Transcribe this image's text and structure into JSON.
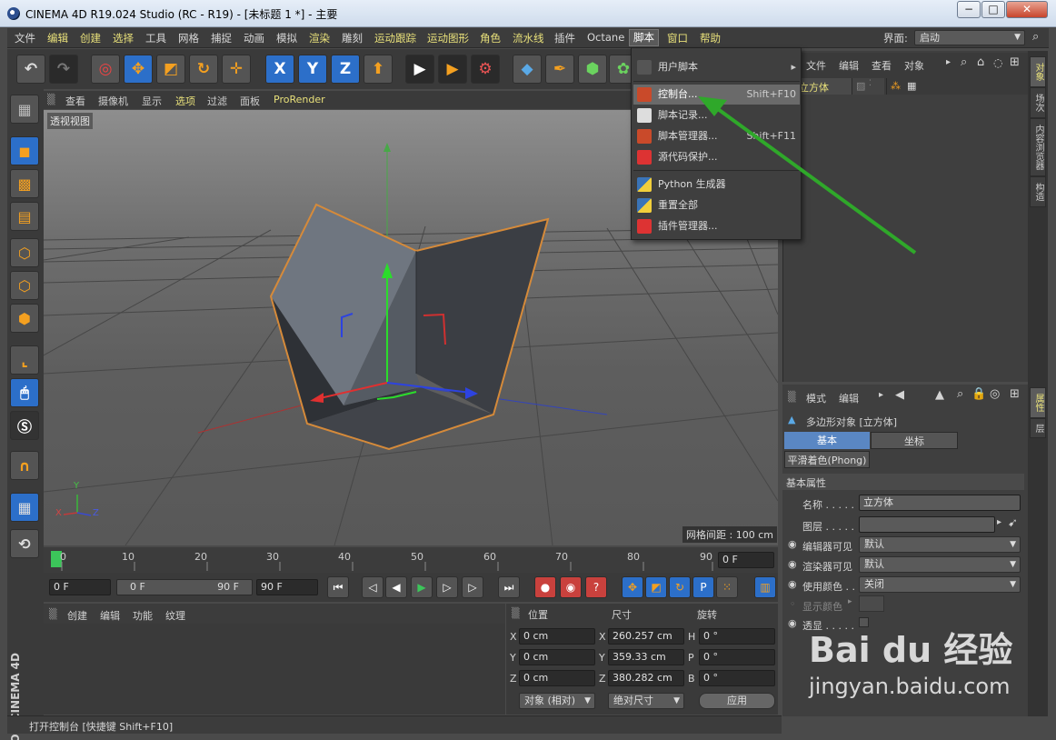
{
  "window": {
    "title": "CINEMA 4D R19.024 Studio (RC - R19) - [未标题 1 *] - 主要",
    "min": "−",
    "max": "□",
    "close": "✕"
  },
  "menubar": {
    "items": [
      {
        "label": "文件",
        "yellow": false
      },
      {
        "label": "编辑",
        "yellow": true
      },
      {
        "label": "创建",
        "yellow": true
      },
      {
        "label": "选择",
        "yellow": true
      },
      {
        "label": "工具",
        "yellow": false
      },
      {
        "label": "网格",
        "yellow": false
      },
      {
        "label": "捕捉",
        "yellow": false
      },
      {
        "label": "动画",
        "yellow": false
      },
      {
        "label": "模拟",
        "yellow": false
      },
      {
        "label": "渲染",
        "yellow": true
      },
      {
        "label": "雕刻",
        "yellow": false
      },
      {
        "label": "运动跟踪",
        "yellow": true
      },
      {
        "label": "运动图形",
        "yellow": true
      },
      {
        "label": "角色",
        "yellow": true
      },
      {
        "label": "流水线",
        "yellow": true
      },
      {
        "label": "插件",
        "yellow": false
      },
      {
        "label": "Octane",
        "yellow": false
      },
      {
        "label": "脚本",
        "yellow": false
      },
      {
        "label": "窗口",
        "yellow": true
      },
      {
        "label": "帮助",
        "yellow": true
      }
    ],
    "layout_label": "界面:",
    "layout_value": "启动"
  },
  "toolbar": {
    "x_label": "X",
    "y_label": "Y",
    "z_label": "Z"
  },
  "viewport": {
    "menu": [
      "查看",
      "摄像机",
      "显示",
      "选项",
      "过滤",
      "面板",
      "ProRender"
    ],
    "view_label": "透视视图",
    "grid_label": "网格间距 : 100 cm",
    "axis_x": "X",
    "axis_y": "Y",
    "axis_z": "Z"
  },
  "dropdown": {
    "items": [
      {
        "label": "用户脚本",
        "shortcut": "",
        "arrow": "▸"
      },
      {
        "label": "控制台...",
        "shortcut": "Shift+F10",
        "highlight": true
      },
      {
        "label": "脚本记录...",
        "shortcut": ""
      },
      {
        "label": "脚本管理器...",
        "shortcut": "Shift+F11"
      },
      {
        "label": "源代码保护...",
        "shortcut": ""
      },
      {
        "label": "Python 生成器",
        "shortcut": ""
      },
      {
        "label": "重置全部",
        "shortcut": ""
      },
      {
        "label": "插件管理器...",
        "shortcut": ""
      }
    ]
  },
  "timeline": {
    "ticks": [
      "0",
      "10",
      "20",
      "30",
      "40",
      "50",
      "60",
      "70",
      "80",
      "90"
    ],
    "current_frame": "0 F",
    "start_frame": "0 F",
    "range_start": "0 F",
    "range_end": "90 F",
    "end_frame": "90 F"
  },
  "material": {
    "menu": [
      "创建",
      "编辑",
      "功能",
      "纹理"
    ]
  },
  "coords": {
    "headers": [
      "位置",
      "尺寸",
      "旋转"
    ],
    "rows": [
      {
        "axis": "X",
        "pos": "0 cm",
        "size_axis": "X",
        "size": "260.257 cm",
        "rot_axis": "H",
        "rot": "0 °"
      },
      {
        "axis": "Y",
        "pos": "0 cm",
        "size_axis": "Y",
        "size": "359.33 cm",
        "rot_axis": "P",
        "rot": "0 °"
      },
      {
        "axis": "Z",
        "pos": "0 cm",
        "size_axis": "Z",
        "size": "380.282 cm",
        "rot_axis": "B",
        "rot": "0 °"
      }
    ],
    "mode": "对象 (相对)",
    "size_mode": "绝对尺寸",
    "apply": "应用"
  },
  "object_manager": {
    "menu": [
      "文件",
      "编辑",
      "查看",
      "对象"
    ],
    "object_name": "立方体"
  },
  "attributes": {
    "menu": [
      "模式",
      "编辑"
    ],
    "title": "多边形对象 [立方体]",
    "tabs": [
      "基本",
      "坐标"
    ],
    "sub_tab": "平滑着色(Phong)",
    "section": "基本属性",
    "name_label": "名称 . . . . .",
    "name_value": "立方体",
    "layer_label": "图层 . . . . .",
    "editor_vis_label": "编辑器可见",
    "editor_vis_value": "默认",
    "render_vis_label": "渲染器可见",
    "render_vis_value": "默认",
    "use_color_label": "使用颜色 . .",
    "use_color_value": "关闭",
    "display_color_label": "显示颜色",
    "xray_label": "透显 . . . . ."
  },
  "side_tabs": [
    "对象",
    "场次",
    "内容浏览器",
    "构造",
    "属性",
    "层"
  ],
  "status": "打开控制台 [快捷键 Shift+F10]",
  "brand": {
    "line1": "MAXON",
    "line2": "CINEMA 4D"
  },
  "watermark": {
    "logo": "Bai du 经验",
    "url": "jingyan.baidu.com"
  },
  "colors": {
    "accent": "#e8e07a",
    "orange": "#f4a020",
    "blue": "#2c6fc9",
    "arrow": "#2fa82a"
  }
}
